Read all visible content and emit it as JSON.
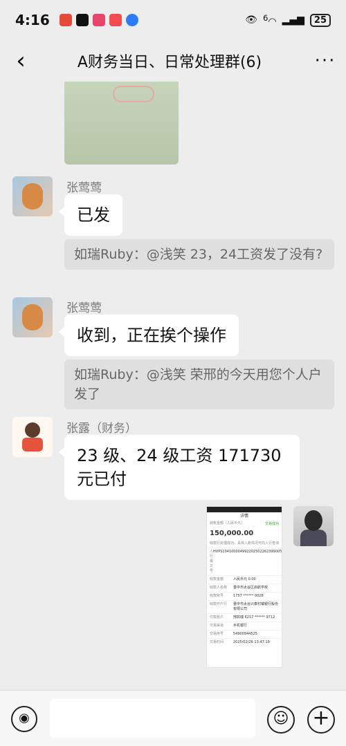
{
  "status_bar": {
    "time": "4:16",
    "battery": "25",
    "signal_label": "6"
  },
  "header": {
    "back_icon": "chevron-left-icon",
    "title": "A财务当日、日常处理群(6)",
    "more_icon": "more-dots-icon"
  },
  "messages": [
    {
      "sender": "张莺莺",
      "text": "已发",
      "quote": "如瑞Ruby：@浅笑 23，24工资发了没有?"
    },
    {
      "sender": "张莺莺",
      "text": "收到，正在挨个操作",
      "quote": "如瑞Ruby：@浅笑 荣邢的今天用您个人户发了"
    },
    {
      "sender": "张露（财务）",
      "text": "23 级、24 级工资 171730 元已付"
    }
  ],
  "receipt": {
    "title": "详情",
    "status": "交易成功",
    "amount_label": "转账金额（人民币元）",
    "amount": "150,000.00",
    "note": "收款行处理成功，具体入账情况可向入行查询",
    "rows": [
      {
        "k": "人行报文号",
        "v": "HVPS104100004992202502262399005"
      },
      {
        "k": "收款金额",
        "v": "人民币元 0.00"
      },
      {
        "k": "收款人名称",
        "v": "晋中市太谷区启航学校"
      },
      {
        "k": "收款账号",
        "v": "1757 ****** 0028"
      },
      {
        "k": "收款开户行",
        "v": "晋中市太谷兴泰村镇银行股份有限公司"
      },
      {
        "k": "付款账户",
        "v": "邢如瑞 6217 ****** 9712"
      },
      {
        "k": "交易渠道",
        "v": "手机银行"
      },
      {
        "k": "交易序号",
        "v": "54900944525"
      },
      {
        "k": "交易时间",
        "v": "2025/02/26 13:47:19"
      }
    ]
  }
}
